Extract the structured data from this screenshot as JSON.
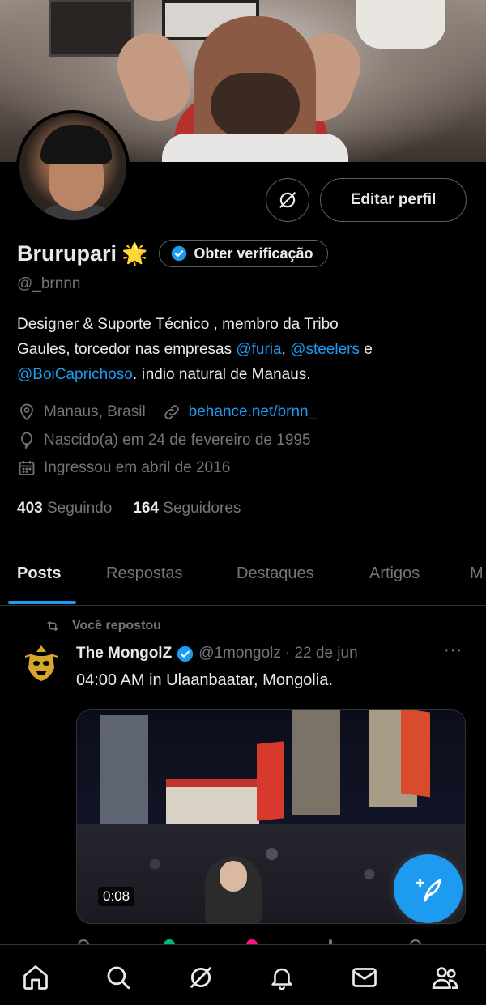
{
  "profile": {
    "name": "Brurupari",
    "emoji": "🌟",
    "handle": "@_brnnn",
    "edit_label": "Editar perfil",
    "verify_label": "Obter verificação",
    "bio": {
      "line1": "Designer & Suporte Técnico , membro da Tribo",
      "line2_pre": "Gaules, torcedor nas empresas ",
      "mention1": "@furia",
      "sep1": ", ",
      "mention2": "@steelers",
      "line2_post": " e",
      "mention3": "@BoiCaprichoso",
      "line3_post": ". índio natural de Manaus."
    },
    "location": "Manaus, Brasil",
    "website": "behance.net/brnn_",
    "birth": "Nascido(a) em 24 de fevereiro de 1995",
    "joined": "Ingressou em abril de 2016",
    "following_count": "403",
    "following_label": "Seguindo",
    "followers_count": "164",
    "followers_label": "Seguidores"
  },
  "tabs": [
    {
      "label": "Posts",
      "active": true
    },
    {
      "label": "Respostas",
      "active": false
    },
    {
      "label": "Destaques",
      "active": false
    },
    {
      "label": "Artigos",
      "active": false
    },
    {
      "label": "M",
      "active": false
    }
  ],
  "tweet": {
    "repost_label": "Você repostou",
    "author_name": "The MongolZ",
    "author_handle": "@1mongolz",
    "date": "· 22 de jun",
    "more": "···",
    "text": "04:00 AM in Ulaanbaatar, Mongolia.",
    "video_duration": "0:08"
  },
  "icons": {
    "grok": "grok-icon",
    "location": "location-pin-icon",
    "link": "link-icon",
    "birthday": "balloon-icon",
    "calendar": "calendar-icon",
    "repost": "repost-icon",
    "verified": "verified-badge-icon",
    "compose": "compose-post-icon",
    "nav": [
      "home-icon",
      "search-icon",
      "grok-icon",
      "notifications-icon",
      "messages-icon",
      "communities-icon"
    ]
  },
  "colors": {
    "accent": "#1d9bf0",
    "background": "#000000",
    "text": "#e7e9ea",
    "muted": "#71767b",
    "border": "#2f3336"
  }
}
